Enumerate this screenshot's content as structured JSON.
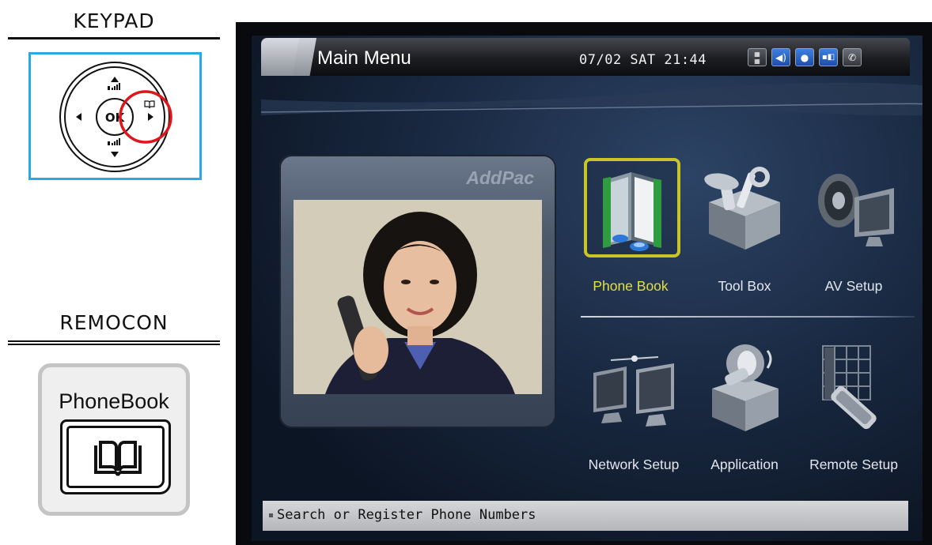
{
  "legend": {
    "keypad_title": "KEYPAD",
    "keypad_ok": "OK",
    "remocon_title": "REMOCON",
    "remocon_button_label": "PhoneBook"
  },
  "screen": {
    "title": "Main Menu",
    "datetime": "07/02 SAT 21:44",
    "brand": "AddPac",
    "status_icons": [
      "dnd-icon",
      "speaker-icon",
      "user-icon",
      "network-icon",
      "phone-icon"
    ],
    "menu": [
      {
        "label": "Phone Book",
        "icon": "phone-book-icon",
        "selected": true
      },
      {
        "label": "Tool Box",
        "icon": "tool-box-icon",
        "selected": false
      },
      {
        "label": "AV Setup",
        "icon": "av-setup-icon",
        "selected": false
      },
      {
        "label": "Network Setup",
        "icon": "network-setup-icon",
        "selected": false
      },
      {
        "label": "Application",
        "icon": "application-icon",
        "selected": false
      },
      {
        "label": "Remote Setup",
        "icon": "remote-setup-icon",
        "selected": false
      }
    ],
    "status_message": "Search or Register Phone Numbers"
  },
  "colors": {
    "keypad_border": "#29a8e4",
    "highlight_circle": "#e0141c",
    "selection": "#c9c524"
  }
}
